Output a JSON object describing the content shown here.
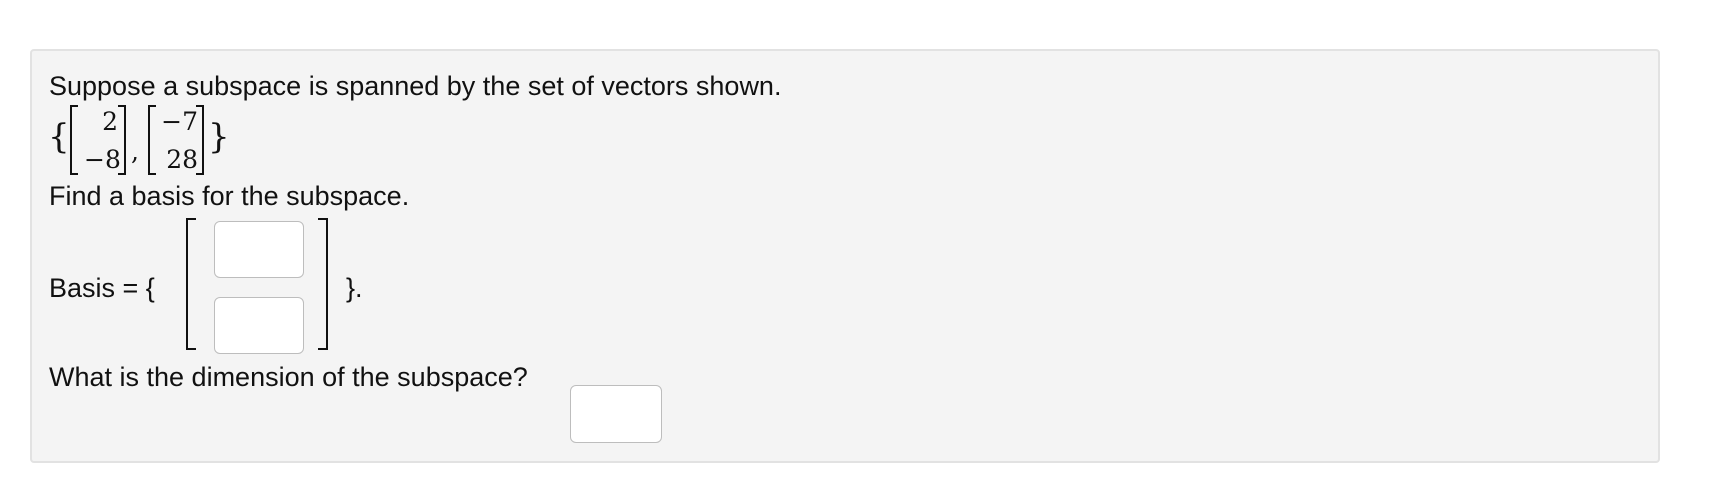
{
  "question": {
    "intro": "Suppose a subspace is spanned by the set of vectors shown.",
    "vector_set": {
      "open_brace": "{",
      "close_brace": "}",
      "separator": ",",
      "vectors": [
        {
          "top": "2",
          "bottom": "−8"
        },
        {
          "top": "−7",
          "bottom": "28"
        }
      ]
    },
    "find_prompt": "Find a basis for the subspace.",
    "basis": {
      "label": "Basis = {",
      "close": "}.",
      "top_value": "",
      "bottom_value": ""
    },
    "dimension": {
      "prompt": "What is the dimension of the subspace?",
      "value": ""
    }
  }
}
